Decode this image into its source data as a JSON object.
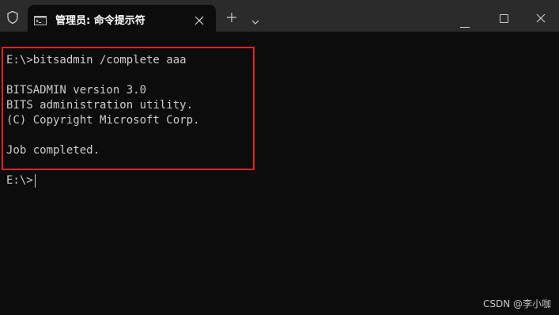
{
  "window": {
    "tab_title": "管理员: 命令提示符",
    "icons": {
      "shield": "shield-icon",
      "tab": "command-prompt-icon",
      "close_tab": "close-icon",
      "new_tab": "plus-icon",
      "dropdown": "chevron-down-icon",
      "minimize": "minimize-icon",
      "maximize": "maximize-icon",
      "close_window": "close-icon"
    }
  },
  "terminal": {
    "lines": [
      "E:\\>bitsadmin /complete aaa",
      "",
      "BITSADMIN version 3.0",
      "BITS administration utility.",
      "(C) Copyright Microsoft Corp.",
      "",
      "Job completed.",
      "",
      "E:\\>"
    ],
    "highlight_color": "#e0232b"
  },
  "watermark": "CSDN @李小咖"
}
